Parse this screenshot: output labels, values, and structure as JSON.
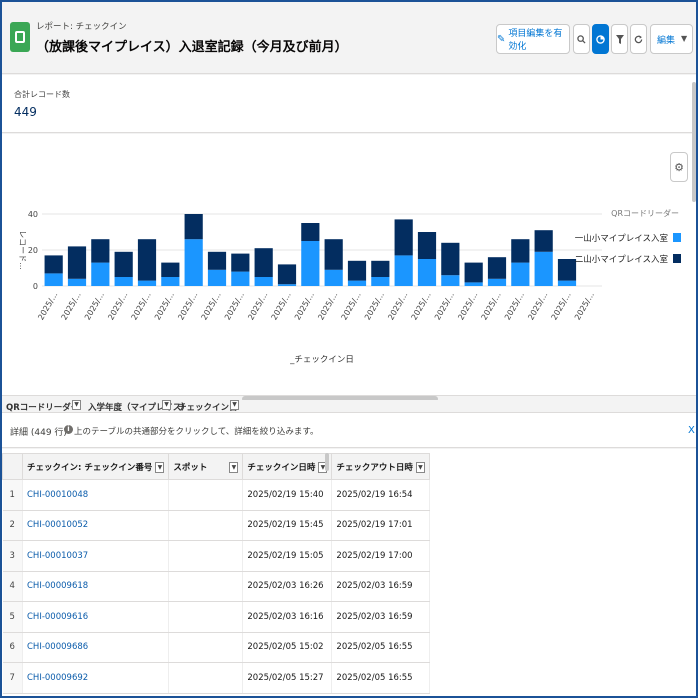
{
  "header": {
    "breadcrumb": "レポート: チェックイン",
    "title": "（放課後マイプレイス）入退室記録（今月及び前月）",
    "enable_field_edit_label": "項目編集を有効化",
    "edit_label": "編集"
  },
  "summary": {
    "label": "合計レコード数",
    "value": "449"
  },
  "chart_data": {
    "type": "bar",
    "stacked": true,
    "title": "",
    "xlabel": "_チェックイン日",
    "ylabel": "レコード...",
    "ylim": [
      0,
      40
    ],
    "yticks": [
      "0",
      "20",
      "40"
    ],
    "legend_title": "QRコードリーダー",
    "legend_position": "right",
    "categories": [
      "2025/...",
      "2025/...",
      "2025/...",
      "2025/...",
      "2025/...",
      "2025/...",
      "2025/...",
      "2025/...",
      "2025/...",
      "2025/...",
      "2025/...",
      "2025/...",
      "2025/...",
      "2025/...",
      "2025/...",
      "2025/...",
      "2025/...",
      "2025/...",
      "2025/...",
      "2025/...",
      "2025/...",
      "2025/...",
      "2025/...",
      "2025/..."
    ],
    "series": [
      {
        "name": "一山小マイプレイス入室",
        "color": "#1b96ff",
        "values": [
          7,
          4,
          13,
          5,
          3,
          5,
          26,
          9,
          8,
          5,
          1,
          25,
          9,
          3,
          5,
          17,
          15,
          6,
          2,
          4,
          13,
          19,
          3,
          0
        ]
      },
      {
        "name": "二山小マイプレイス入室",
        "color": "#032d60",
        "values": [
          10,
          18,
          13,
          14,
          23,
          8,
          14,
          10,
          10,
          16,
          11,
          10,
          17,
          11,
          9,
          20,
          15,
          18,
          11,
          12,
          13,
          12,
          12,
          0
        ]
      }
    ],
    "grid": true
  },
  "grouping": {
    "col1": "QRコードリーダー",
    "col2": "入学年度（マイプレイス）",
    "col3": "チェックイン日"
  },
  "details": {
    "label": "詳細 (449 行)",
    "hint": "上のテーブルの共通部分をクリックして、詳細を絞り込みます。",
    "close": "X"
  },
  "table": {
    "columns": [
      "チェックイン: チェックイン番号",
      "スポット",
      "チェックイン日時",
      "チェックアウト日時"
    ],
    "rows": [
      {
        "n": "1",
        "id": "CHI-00010048",
        "spot": "",
        "in": "2025/02/19 15:40",
        "out": "2025/02/19 16:54"
      },
      {
        "n": "2",
        "id": "CHI-00010052",
        "spot": "",
        "in": "2025/02/19 15:45",
        "out": "2025/02/19 17:01"
      },
      {
        "n": "3",
        "id": "CHI-00010037",
        "spot": "",
        "in": "2025/02/19 15:05",
        "out": "2025/02/19 17:00"
      },
      {
        "n": "4",
        "id": "CHI-00009618",
        "spot": "",
        "in": "2025/02/03 16:26",
        "out": "2025/02/03 16:59"
      },
      {
        "n": "5",
        "id": "CHI-00009616",
        "spot": "",
        "in": "2025/02/03 16:16",
        "out": "2025/02/03 16:59"
      },
      {
        "n": "6",
        "id": "CHI-00009686",
        "spot": "",
        "in": "2025/02/05 15:02",
        "out": "2025/02/05 16:55"
      },
      {
        "n": "7",
        "id": "CHI-00009692",
        "spot": "",
        "in": "2025/02/05 15:27",
        "out": "2025/02/05 16:55"
      }
    ]
  },
  "colors": {
    "brand": "#0176d3",
    "series_light": "#1b96ff",
    "series_dark": "#032d60",
    "app_icon": "#3ba755"
  }
}
